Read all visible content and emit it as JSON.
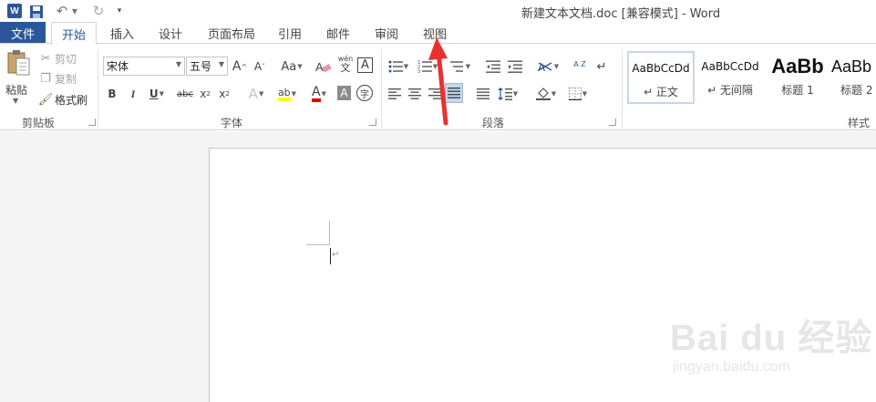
{
  "quick_access": {
    "app_icon_letter": "W",
    "icons": [
      "word-logo-icon",
      "save-icon",
      "undo-icon",
      "redo-icon",
      "customize-dropdown-icon"
    ]
  },
  "window": {
    "title": "新建文本文档.doc [兼容模式] - Word"
  },
  "tabs": {
    "file": "文件",
    "home": "开始",
    "insert": "插入",
    "design": "设计",
    "layout": "页面布局",
    "references": "引用",
    "mailings": "邮件",
    "review": "审阅",
    "view": "视图"
  },
  "clipboard": {
    "paste": "粘贴",
    "cut": "剪切",
    "copy": "复制",
    "format_painter": "格式刷",
    "group_label": "剪贴板"
  },
  "font": {
    "font_name": "宋体",
    "font_size": "五号",
    "grow": "A",
    "shrink": "A",
    "change_case": "Aa",
    "clear_format_icon": "eraser-icon",
    "phonetic": "wén",
    "phonetic_char": "文",
    "char_border": "A",
    "bold": "B",
    "italic": "I",
    "underline": "U",
    "strikethrough": "abc",
    "subscript": "x",
    "subscript_mark": "2",
    "superscript": "x",
    "superscript_mark": "2",
    "text_effect": "A",
    "highlight": "ab",
    "font_color": "A",
    "char_shading": "A",
    "enclose_char": "字",
    "group_label": "字体",
    "colors": {
      "highlight": "#ffff00",
      "font_color": "#e00000"
    }
  },
  "paragraph": {
    "sort": "A Z",
    "group_label": "段落"
  },
  "styles": {
    "items": [
      {
        "preview": "AaBbCcDd",
        "name": "↵ 正文"
      },
      {
        "preview": "AaBbCcDd",
        "name": "↵ 无间隔"
      },
      {
        "preview": "AaBb",
        "name": "标题 1"
      },
      {
        "preview": "AaBb",
        "name": "标题 2"
      }
    ],
    "group_label": "样式"
  },
  "document": {
    "paragraph_mark": "↵"
  },
  "watermark": {
    "main": "Bai du 经验",
    "sub": "jingyan.baidu.com"
  },
  "colors": {
    "accent": "#2b579a",
    "annotation": "#e8312f"
  }
}
